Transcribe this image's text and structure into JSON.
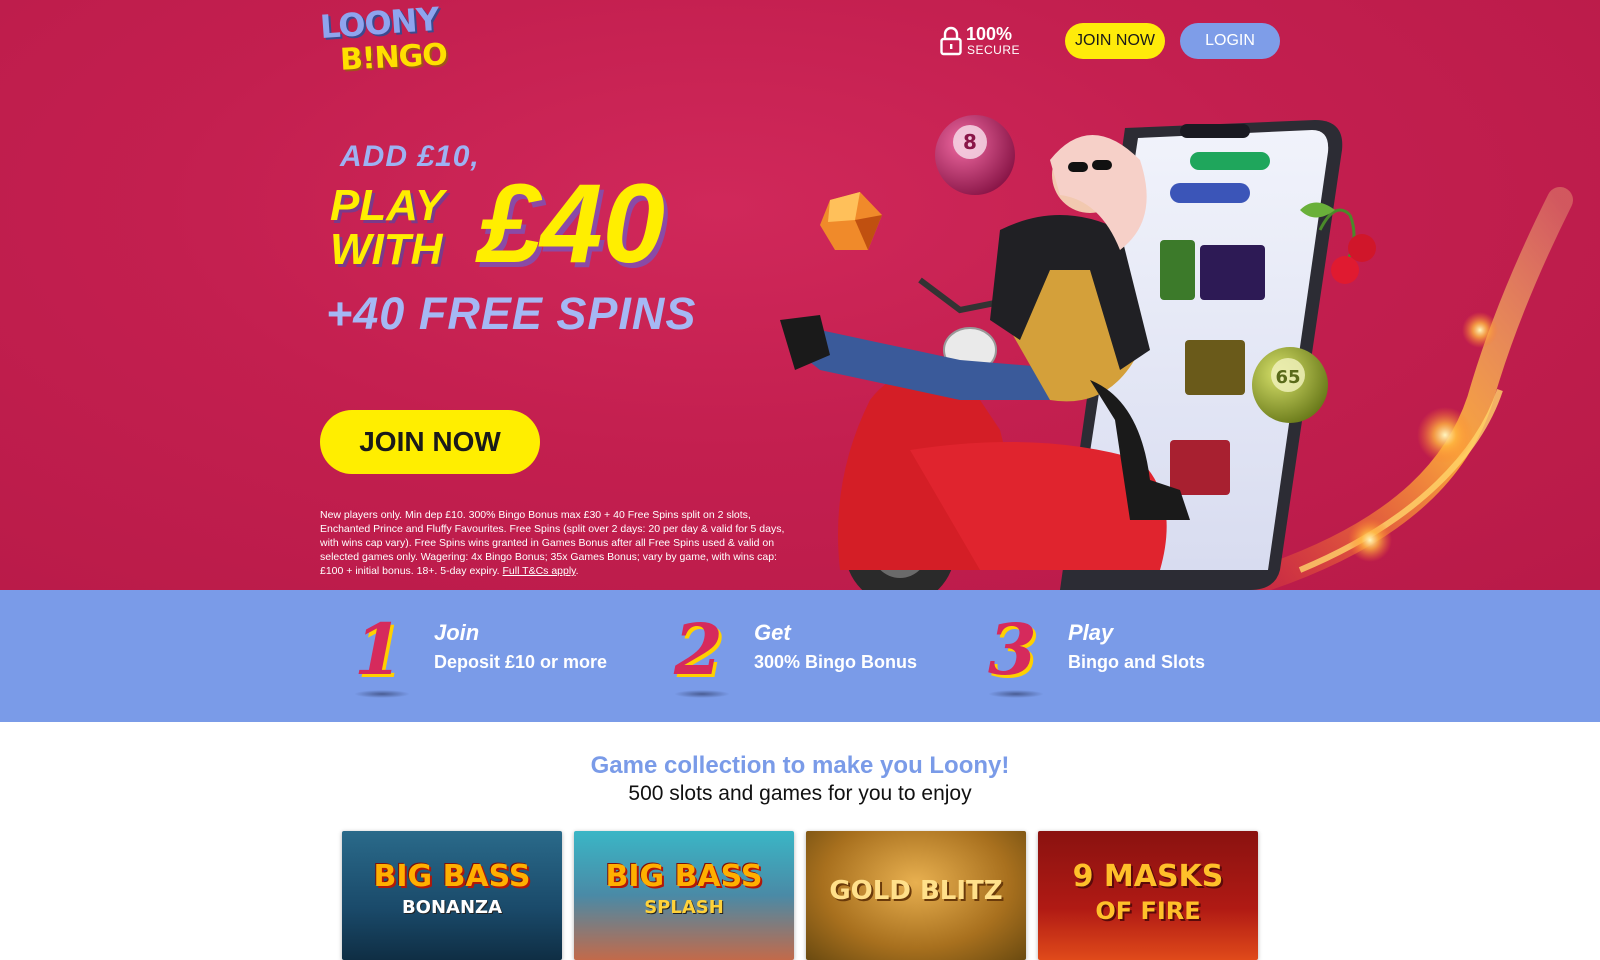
{
  "header": {
    "logo_top": "LOONY",
    "logo_bottom": "B!NGO",
    "secure_pct": "100%",
    "secure_label": "SECURE",
    "join_label": "JOIN NOW",
    "login_label": "LOGIN"
  },
  "hero": {
    "add_text": "ADD £10,",
    "play_line1": "PLAY",
    "play_line2": "WITH",
    "amount": "£40",
    "spins_text": "+40 FREE SPINS",
    "join_label": "JOIN NOW",
    "terms_text": "New players only. Min dep £10. 300% Bingo Bonus max £30 + 40 Free Spins split on 2 slots, Enchanted Prince and Fluffy Favourites. Free Spins (split over 2 days: 20 per day & valid for 5 days, with wins cap vary). Free Spins wins granted in Games Bonus after all Free Spins used & valid on selected games only. Wagering: 4x Bingo Bonus; 35x Games Bonus; vary by game, with wins cap: £100 + initial bonus. 18+. 5-day expiry.",
    "terms_link": "Full T&Cs apply",
    "ball_left": "8",
    "ball_right": "65"
  },
  "steps": [
    {
      "num": "1",
      "title": "Join",
      "desc": "Deposit £10 or more"
    },
    {
      "num": "2",
      "title": "Get",
      "desc": "300% Bingo Bonus"
    },
    {
      "num": "3",
      "title": "Play",
      "desc": "Bingo and Slots"
    }
  ],
  "games": {
    "title": "Game collection to make you Loony!",
    "subtitle": "500 slots and games for you to enjoy",
    "cards": [
      {
        "title": "BIG BASS",
        "sub": "BONANZA"
      },
      {
        "title": "BIG BASS",
        "sub": "SPLASH"
      },
      {
        "title": "GOLD BLITZ",
        "sub": ""
      },
      {
        "title": "9 MASKS",
        "sub": "OF FIRE"
      }
    ]
  },
  "colors": {
    "hero_bg": "#c31f4f",
    "accent_yellow": "#ffee00",
    "accent_blue": "#7a9be8"
  }
}
